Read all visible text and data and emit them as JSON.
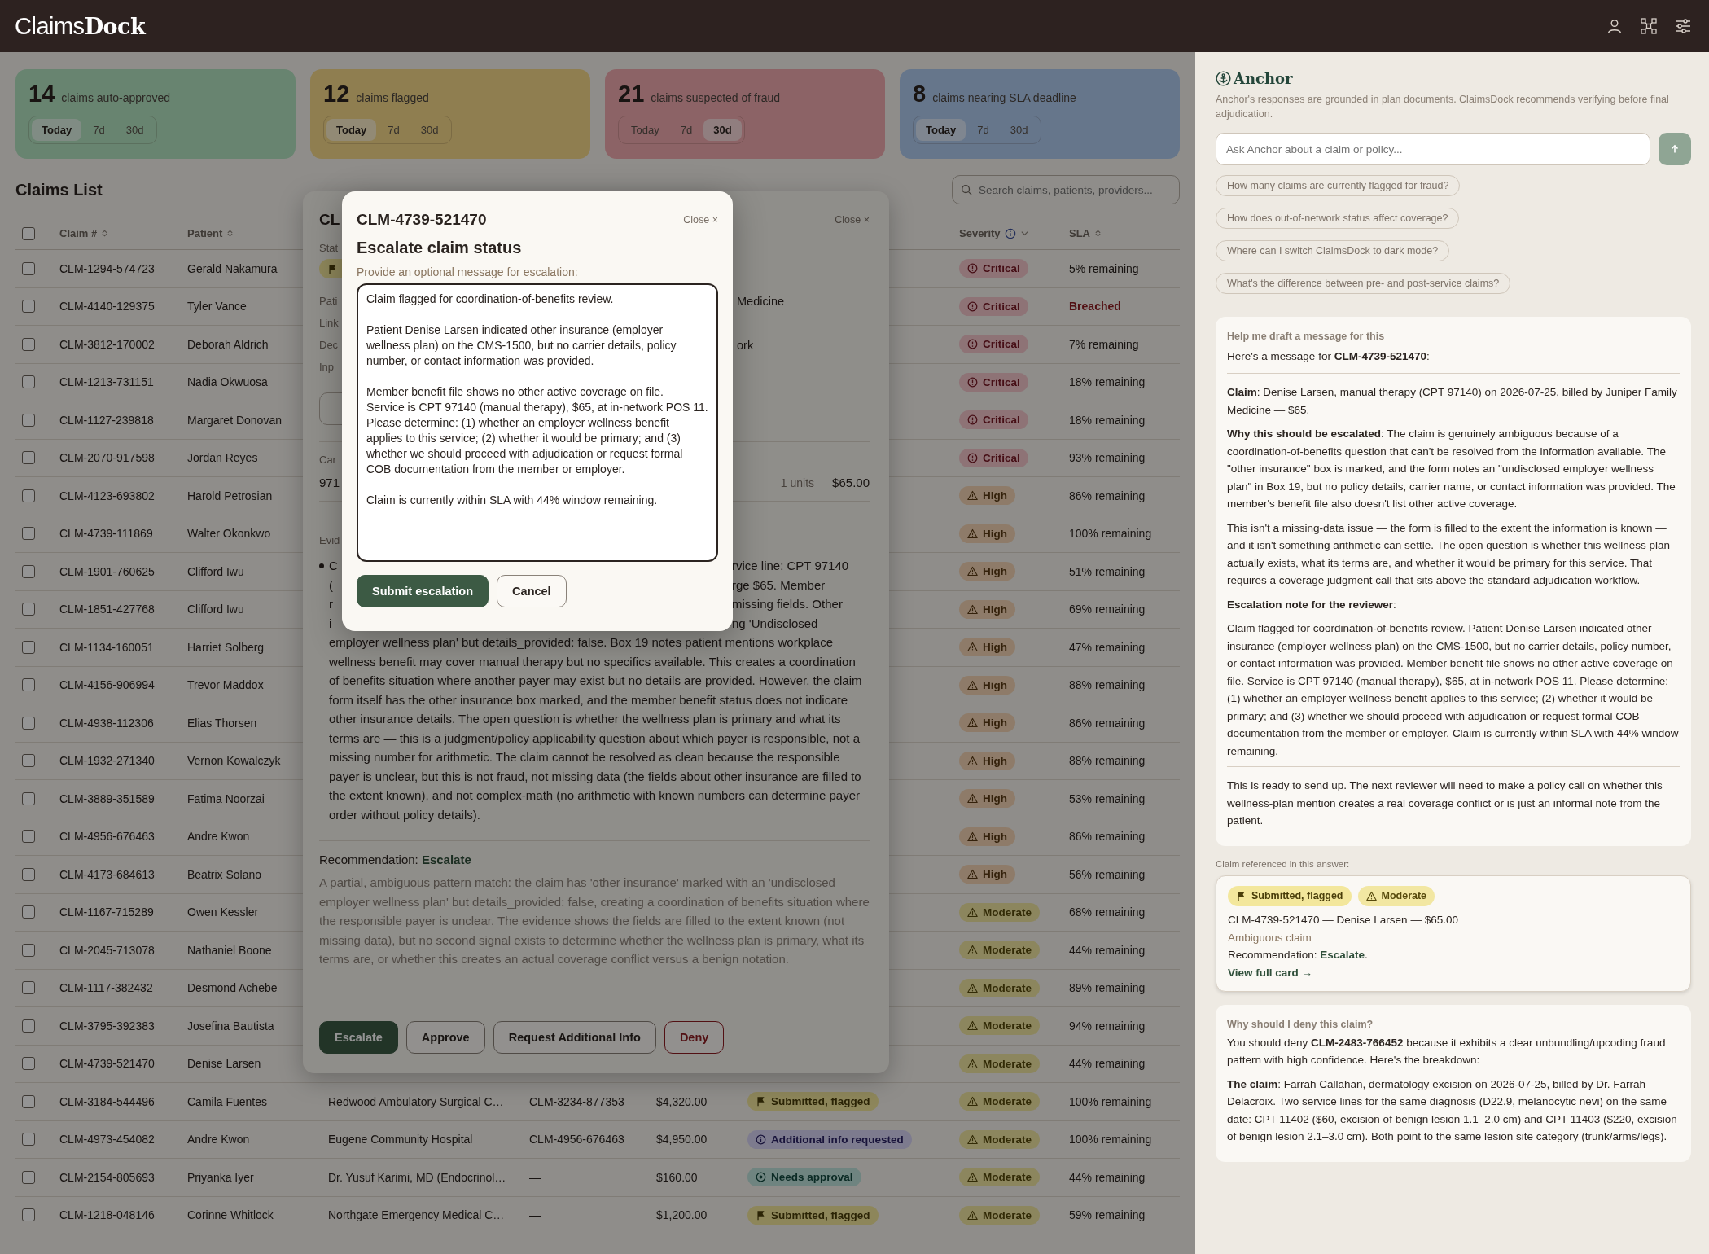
{
  "app": {
    "logo_regular": "Claims",
    "logo_bold": "Dock"
  },
  "stats": [
    {
      "count": "14",
      "label": "claims auto-approved",
      "kind": "approved",
      "ranges": [
        {
          "label": "Today",
          "selected": true
        },
        {
          "label": "7d",
          "selected": false
        },
        {
          "label": "30d",
          "selected": false
        }
      ]
    },
    {
      "count": "12",
      "label": "claims flagged",
      "kind": "flagged",
      "ranges": [
        {
          "label": "Today",
          "selected": true
        },
        {
          "label": "7d",
          "selected": false
        },
        {
          "label": "30d",
          "selected": false
        }
      ]
    },
    {
      "count": "21",
      "label": "claims suspected of fraud",
      "kind": "fraud",
      "ranges": [
        {
          "label": "Today",
          "selected": false
        },
        {
          "label": "7d",
          "selected": false
        },
        {
          "label": "30d",
          "selected": true
        }
      ]
    },
    {
      "count": "8",
      "label": "claims nearing SLA deadline",
      "kind": "deadline",
      "ranges": [
        {
          "label": "Today",
          "selected": true
        },
        {
          "label": "7d",
          "selected": false
        },
        {
          "label": "30d",
          "selected": false
        }
      ]
    }
  ],
  "claims_list": {
    "title": "Claims List",
    "search": {
      "placeholder": "Search claims, patients, providers..."
    },
    "all_checked": false,
    "columns": [
      {
        "label": "Claim #",
        "kind": "sort"
      },
      {
        "label": "Patient",
        "kind": "sort"
      },
      {
        "label": "Severity",
        "kind": "filter"
      },
      {
        "label": "SLA",
        "kind": "sort"
      }
    ],
    "rows": [
      {
        "claim": "CLM-1294-574723",
        "patient": "Gerald Nakamura",
        "checked": false,
        "severity": {
          "label": "Critical",
          "kind": "critical"
        },
        "sla": "5% remaining",
        "breached": false
      },
      {
        "claim": "CLM-4140-129375",
        "patient": "Tyler Vance",
        "checked": false,
        "severity": {
          "label": "Critical",
          "kind": "critical"
        },
        "sla": "Breached",
        "breached": true
      },
      {
        "claim": "CLM-3812-170002",
        "patient": "Deborah Aldrich",
        "checked": false,
        "severity": {
          "label": "Critical",
          "kind": "critical"
        },
        "sla": "7% remaining",
        "breached": false
      },
      {
        "claim": "CLM-1213-731151",
        "patient": "Nadia Okwuosa",
        "checked": false,
        "severity": {
          "label": "Critical",
          "kind": "critical"
        },
        "sla": "18% remaining",
        "breached": false
      },
      {
        "claim": "CLM-1127-239818",
        "patient": "Margaret Donovan",
        "checked": false,
        "severity": {
          "label": "Critical",
          "kind": "critical"
        },
        "sla": "18% remaining",
        "breached": false
      },
      {
        "claim": "CLM-2070-917598",
        "patient": "Jordan Reyes",
        "checked": false,
        "severity": {
          "label": "Critical",
          "kind": "critical"
        },
        "sla": "93% remaining",
        "breached": false
      },
      {
        "claim": "CLM-4123-693802",
        "patient": "Harold Petrosian",
        "checked": false,
        "severity": {
          "label": "High",
          "kind": "high"
        },
        "sla": "86% remaining",
        "breached": false
      },
      {
        "claim": "CLM-4739-111869",
        "patient": "Walter Okonkwo",
        "checked": false,
        "severity": {
          "label": "High",
          "kind": "high"
        },
        "sla": "100% remaining",
        "breached": false
      },
      {
        "claim": "CLM-1901-760625",
        "patient": "Clifford Iwu",
        "checked": false,
        "severity": {
          "label": "High",
          "kind": "high"
        },
        "sla": "51% remaining",
        "breached": false
      },
      {
        "claim": "CLM-1851-427768",
        "patient": "Clifford Iwu",
        "checked": false,
        "severity": {
          "label": "High",
          "kind": "high"
        },
        "sla": "69% remaining",
        "breached": false
      },
      {
        "claim": "CLM-1134-160051",
        "patient": "Harriet Solberg",
        "checked": false,
        "severity": {
          "label": "High",
          "kind": "high"
        },
        "sla": "47% remaining",
        "breached": false
      },
      {
        "claim": "CLM-4156-906994",
        "patient": "Trevor Maddox",
        "checked": false,
        "severity": {
          "label": "High",
          "kind": "high"
        },
        "sla": "88% remaining",
        "breached": false
      },
      {
        "claim": "CLM-4938-112306",
        "patient": "Elias Thorsen",
        "checked": false,
        "severity": {
          "label": "High",
          "kind": "high"
        },
        "sla": "86% remaining",
        "breached": false
      },
      {
        "claim": "CLM-1932-271340",
        "patient": "Vernon Kowalczyk",
        "checked": false,
        "severity": {
          "label": "High",
          "kind": "high"
        },
        "sla": "88% remaining",
        "breached": false
      },
      {
        "claim": "CLM-3889-351589",
        "patient": "Fatima Noorzai",
        "checked": false,
        "severity": {
          "label": "High",
          "kind": "high"
        },
        "sla": "53% remaining",
        "breached": false
      },
      {
        "claim": "CLM-4956-676463",
        "patient": "Andre Kwon",
        "checked": false,
        "severity": {
          "label": "High",
          "kind": "high"
        },
        "sla": "86% remaining",
        "breached": false
      },
      {
        "claim": "CLM-4173-684613",
        "patient": "Beatrix Solano",
        "checked": false,
        "severity": {
          "label": "High",
          "kind": "high"
        },
        "sla": "56% remaining",
        "breached": false
      },
      {
        "claim": "CLM-1167-715289",
        "patient": "Owen Kessler",
        "checked": false,
        "severity": {
          "label": "Moderate",
          "kind": "moderate"
        },
        "sla": "68% remaining",
        "breached": false
      },
      {
        "claim": "CLM-2045-713078",
        "patient": "Nathaniel Boone",
        "checked": false,
        "severity": {
          "label": "Moderate",
          "kind": "moderate"
        },
        "sla": "44% remaining",
        "breached": false
      },
      {
        "claim": "CLM-1117-382432",
        "patient": "Desmond Achebe",
        "checked": false,
        "severity": {
          "label": "Moderate",
          "kind": "moderate"
        },
        "sla": "89% remaining",
        "breached": false
      },
      {
        "claim": "CLM-3795-392383",
        "patient": "Josefina Bautista",
        "checked": false,
        "severity": {
          "label": "Moderate",
          "kind": "moderate"
        },
        "sla": "94% remaining",
        "breached": false
      },
      {
        "claim": "CLM-4739-521470",
        "patient": "Denise Larsen",
        "checked": false,
        "severity": {
          "label": "Moderate",
          "kind": "moderate"
        },
        "sla": "44% remaining",
        "breached": false
      },
      {
        "claim": "CLM-3184-544496",
        "patient": "Camila Fuentes",
        "provider": "Redwood Ambulatory Surgical C…",
        "linked": "CLM-3234-877353",
        "amount": "$4,320.00",
        "status": {
          "label": "Submitted, flagged",
          "kind": "flagged"
        },
        "checked": false,
        "severity": {
          "label": "Moderate",
          "kind": "moderate"
        },
        "sla": "100% remaining",
        "breached": false
      },
      {
        "claim": "CLM-4973-454082",
        "patient": "Andre Kwon",
        "provider": "Eugene Community Hospital",
        "linked": "CLM-4956-676463",
        "amount": "$4,950.00",
        "status": {
          "label": "Additional info requested",
          "kind": "info"
        },
        "checked": false,
        "severity": {
          "label": "Moderate",
          "kind": "moderate"
        },
        "sla": "100% remaining",
        "breached": false
      },
      {
        "claim": "CLM-2154-805693",
        "patient": "Priyanka Iyer",
        "provider": "Dr. Yusuf Karimi, MD (Endocrinol…",
        "linked": "—",
        "amount": "$160.00",
        "status": {
          "label": "Needs approval",
          "kind": "approval"
        },
        "checked": false,
        "severity": {
          "label": "Moderate",
          "kind": "moderate"
        },
        "sla": "44% remaining",
        "breached": false
      },
      {
        "claim": "CLM-1218-048146",
        "patient": "Corinne Whitlock",
        "provider": "Northgate Emergency Medical C…",
        "linked": "—",
        "amount": "$1,200.00",
        "status": {
          "label": "Submitted, flagged",
          "kind": "flagged"
        },
        "checked": false,
        "severity": {
          "label": "Moderate",
          "kind": "moderate"
        },
        "sla": "59% remaining",
        "breached": false
      }
    ]
  },
  "detail_modal": {
    "title": "CL",
    "close": "Close ×",
    "status_label": "Stat",
    "status_badge": {
      "kind": "flagged"
    },
    "fields": [
      {
        "label": "Pati",
        "value": "Medicine"
      },
      {
        "label": "Link"
      },
      {
        "label": "Dec",
        "value": "ork"
      },
      {
        "label": "Inp"
      }
    ],
    "service_label": "Car",
    "service_code": "971",
    "units": "1 units",
    "amount": "$65.00",
    "evidence_label": "Evid",
    "evidence_fragments": [
      {
        "left": "C",
        "right": "rvice line: CPT 97140"
      },
      {
        "left": "(",
        "right": "rge $65. Member"
      },
      {
        "left": "r",
        "right": "missing fields. Other"
      },
      {
        "left": "i",
        "right": "ng 'Undisclosed"
      }
    ],
    "evidence_text": "employer wellness plan' but details_provided: false. Box 19 notes patient mentions workplace wellness benefit may cover manual therapy but no specifics available. This creates a coordination of benefits situation where another payer may exist but no details are provided. However, the claim form itself has the other insurance box marked, and the member benefit status does not indicate other insurance details. The open question is whether the wellness plan is primary and what its terms are — this is a judgment/policy applicability question about which payer is responsible, not a missing number for arithmetic. The claim cannot be resolved as clean because the responsible payer is unclear, but this is not fraud, not missing data (the fields about other insurance are filled to the extent known), and not complex-math (no arithmetic with known numbers can determine payer order without policy details).",
    "recommendation": "Recommendation: **Escalate**",
    "rationale": "A partial, ambiguous pattern match: the claim has 'other insurance' marked with an 'undisclosed employer wellness plan' but details_provided: false, creating a coordination of benefits situation where the responsible payer is unclear. The evidence shows the fields are filled to the extent known (not missing data), but no second signal exists to determine whether the wellness plan is primary, what its terms are, or whether this creates an actual coverage conflict versus a benign notation.",
    "actions": [
      {
        "label": "Escalate",
        "kind": "primary"
      },
      {
        "label": "Approve",
        "kind": "outline"
      },
      {
        "label": "Request Additional Info",
        "kind": "outline"
      },
      {
        "label": "Deny",
        "kind": "danger"
      }
    ]
  },
  "escalate_modal": {
    "claim_id": "CLM-4739-521470",
    "close": "Close ×",
    "title": "Escalate claim status",
    "prompt": "Provide an optional message for escalation:",
    "message": "Claim flagged for coordination-of-benefits review.\n\nPatient Denise Larsen indicated other insurance (employer wellness plan) on the CMS-1500, but no carrier details, policy number, or contact information was provided.\n\nMember benefit file shows no other active coverage on file.\nService is CPT 97140 (manual therapy), $65, at in-network POS 11.\nPlease determine: (1) whether an employer wellness benefit applies to this service; (2) whether it would be primary; and (3) whether we should proceed with adjudication or request formal COB documentation from the member or employer.\n\nClaim is currently within SLA with 44% window remaining.",
    "actions": [
      {
        "label": "Submit escalation",
        "kind": "primary"
      },
      {
        "label": "Cancel",
        "kind": "outline"
      }
    ]
  },
  "assistant": {
    "title": "Anchor",
    "disclaimer": "Anchor's responses are grounded in plan documents. ClaimsDock recommends verifying before final adjudication.",
    "input": {
      "placeholder": "Ask Anchor about a claim or policy..."
    },
    "suggestions": [
      "How many claims are currently flagged for fraud?",
      "How does out-of-network status affect coverage?",
      "Where can I switch ClaimsDock to dark mode?",
      "What's the difference between pre- and post-service claims?"
    ],
    "answers": [
      {
        "question": "Help me draft a message for this",
        "blocks": [
          {
            "kind": "lead",
            "text": "Here's a message for **CLM-4739-521470**:"
          },
          {
            "kind": "rule"
          },
          {
            "kind": "para",
            "text": "**Claim**: Denise Larsen, manual therapy (CPT 97140) on 2026-07-25, billed by Juniper Family Medicine — $65."
          },
          {
            "kind": "para",
            "text": "**Why this should be escalated**: The claim is genuinely ambiguous because of a coordination-of-benefits question that can't be resolved from the information available. The \"other insurance\" box is marked, and the form notes an \"undisclosed employer wellness plan\" in Box 19, but no policy details, carrier name, or contact information was provided. The member's benefit file also doesn't list other active coverage."
          },
          {
            "kind": "para",
            "text": "This isn't a missing-data issue — the form is filled to the extent the information is known — and it isn't something arithmetic can settle. The open question is whether this wellness plan actually exists, what its terms are, and whether it would be primary for this service. That requires a coverage judgment call that sits above the standard adjudication workflow."
          },
          {
            "kind": "para",
            "text": "**Escalation note for the reviewer**:"
          },
          {
            "kind": "para",
            "text": "Claim flagged for coordination-of-benefits review. Patient Denise Larsen indicated other insurance (employer wellness plan) on the CMS-1500, but no carrier details, policy number, or contact information was provided. Member benefit file shows no other active coverage on file. Service is CPT 97140 (manual therapy), $65, at in-network POS 11. Please determine: (1) whether an employer wellness benefit applies to this service; (2) whether it would be primary; and (3) whether we should proceed with adjudication or request formal COB documentation from the member or employer. Claim is currently within SLA with 44% window remaining."
          },
          {
            "kind": "rule"
          },
          {
            "kind": "para",
            "text": "This is ready to send up. The next reviewer will need to make a policy call on whether this wellness-plan mention creates a real coverage conflict or is just an informal note from the patient."
          }
        ],
        "reference": {
          "label": "Claim referenced in this answer:",
          "badges": [
            {
              "label": "Submitted, flagged",
              "kind": "flagged"
            },
            {
              "label": "Moderate",
              "kind": "moderate"
            }
          ],
          "summary": "CLM-4739-521470 — Denise Larsen — $65.00",
          "tag": "Ambiguous claim",
          "recommendation": "Recommendation: **Escalate**.",
          "link": "View full card →"
        }
      },
      {
        "question": "Why should I deny this claim?",
        "blocks": [
          {
            "kind": "para",
            "text": "You should deny **CLM-2483-766452** because it exhibits a clear unbundling/upcoding fraud pattern with high confidence. Here's the breakdown:"
          },
          {
            "kind": "para",
            "text": "**The claim**: Farrah Callahan, dermatology excision on 2026-07-25, billed by Dr. Farrah Delacroix. Two service lines for the same diagnosis (D22.9, melanocytic nevi) on the same date: CPT 11402 ($60, excision of benign lesion 1.1–2.0 cm) and CPT 11403 ($220, excision of benign lesion 2.1–3.0 cm). Both point to the same lesion site category (trunk/arms/legs)."
          }
        ]
      }
    ]
  }
}
